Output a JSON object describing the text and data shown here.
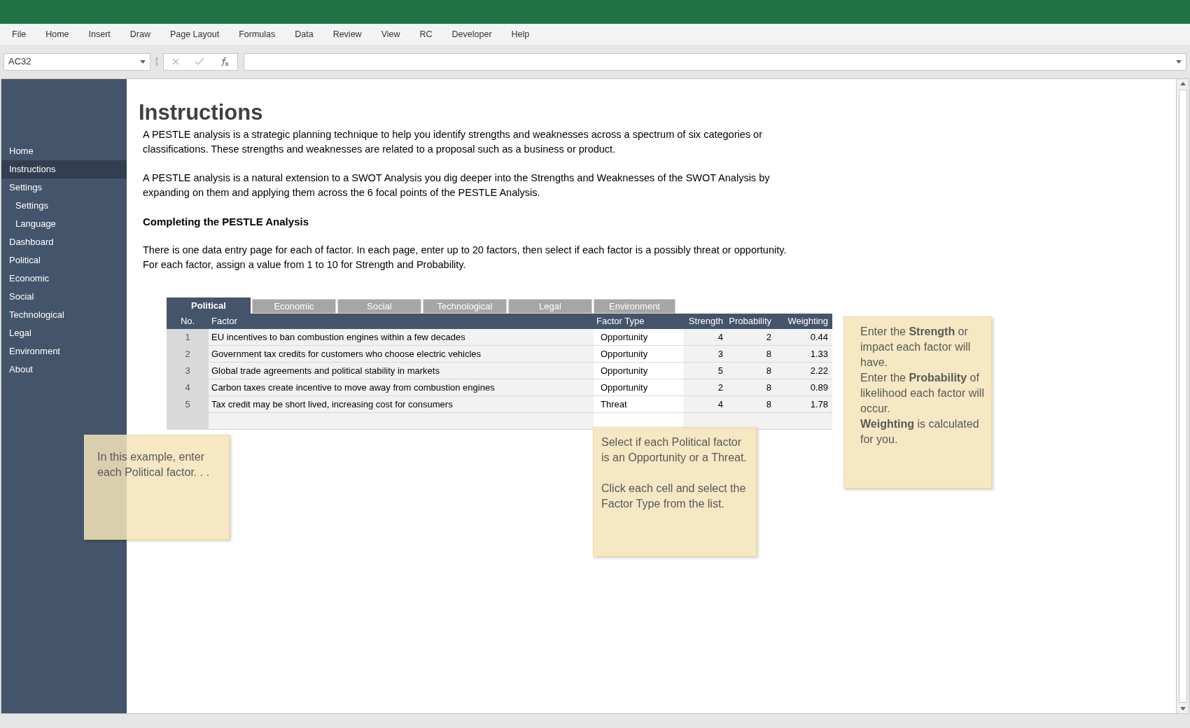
{
  "menu": [
    "File",
    "Home",
    "Insert",
    "Draw",
    "Page Layout",
    "Formulas",
    "Data",
    "Review",
    "View",
    "RC",
    "Developer",
    "Help"
  ],
  "formula_bar": {
    "name_box": "AC32"
  },
  "sidebar": {
    "items": [
      {
        "label": "Home",
        "selected": false
      },
      {
        "label": "Instructions",
        "selected": true
      },
      {
        "label": "Settings",
        "selected": false,
        "children": [
          {
            "label": "Settings",
            "selected": false
          },
          {
            "label": "Language",
            "selected": false
          }
        ]
      },
      {
        "label": "Dashboard",
        "selected": false
      },
      {
        "label": "Political",
        "selected": false
      },
      {
        "label": "Economic",
        "selected": false
      },
      {
        "label": "Social",
        "selected": false
      },
      {
        "label": "Technological",
        "selected": false
      },
      {
        "label": "Legal",
        "selected": false
      },
      {
        "label": "Environment",
        "selected": false
      },
      {
        "label": "About",
        "selected": false
      }
    ]
  },
  "content": {
    "heading": "Instructions",
    "blocks": [
      {
        "kind": "paragraph",
        "text": "A PESTLE analysis is a strategic planning technique to help you identify strengths and weaknesses across a spectrum of six categories or classifications. These strengths and weaknesses are related to a proposal such as a business or product."
      },
      {
        "kind": "paragraph",
        "text": "A PESTLE analysis is a natural extension to a SWOT Analysis you dig deeper into the Strengths and Weaknesses of the SWOT Analysis by expanding on them and applying them across the 6 focal points of the PESTLE Analysis."
      },
      {
        "kind": "subheading",
        "text": "Completing the PESTLE Analysis"
      },
      {
        "kind": "paragraph",
        "text": "There is one data entry page for each of factor. In each page, enter up to 20 factors, then select if each factor is a possibly threat or opportunity. For each factor, assign a value from 1 to 10 for Strength and Probability."
      }
    ]
  },
  "table": {
    "tabs": [
      {
        "label": "Political",
        "selected": true
      },
      {
        "label": "Economic",
        "selected": false
      },
      {
        "label": "Social",
        "selected": false
      },
      {
        "label": "Technological",
        "selected": false
      },
      {
        "label": "Legal",
        "selected": false
      },
      {
        "label": "Environment",
        "selected": false
      }
    ],
    "columns": [
      "No.",
      "Factor",
      "Factor Type",
      "Strength",
      "Probability",
      "Weighting"
    ],
    "rows": [
      {
        "no": "1",
        "factor": "EU incentives to ban combustion engines within a few decades",
        "factor_type": "Opportunity",
        "strength": "4",
        "probability": "2",
        "weighting": "0.44"
      },
      {
        "no": "2",
        "factor": "Government tax credits for customers who choose electric vehicles",
        "factor_type": "Opportunity",
        "strength": "3",
        "probability": "8",
        "weighting": "1.33"
      },
      {
        "no": "3",
        "factor": "Global trade agreements and political stability in markets",
        "factor_type": "Opportunity",
        "strength": "5",
        "probability": "8",
        "weighting": "2.22"
      },
      {
        "no": "4",
        "factor": "Carbon taxes create incentive to move away from combustion engines",
        "factor_type": "Opportunity",
        "strength": "2",
        "probability": "8",
        "weighting": "0.89"
      },
      {
        "no": "5",
        "factor": "Tax credit may be short lived, increasing cost for consumers",
        "factor_type": "Threat",
        "strength": "4",
        "probability": "8",
        "weighting": "1.78"
      }
    ]
  },
  "callouts": [
    {
      "paragraphs": [
        "In this example, enter each Political factor. . ."
      ]
    },
    {
      "paragraphs": [
        "Select if each Political factor is an Opportunity or a Threat.",
        "Click each cell and select the Factor Type from the list."
      ]
    },
    {
      "paragraphs": [
        "Enter the **Strength** or impact each factor will have.",
        "Enter the **Probability** of likelihood each factor will occur.",
        "**Weighting** is calculated for you."
      ],
      "spaced": false
    }
  ]
}
